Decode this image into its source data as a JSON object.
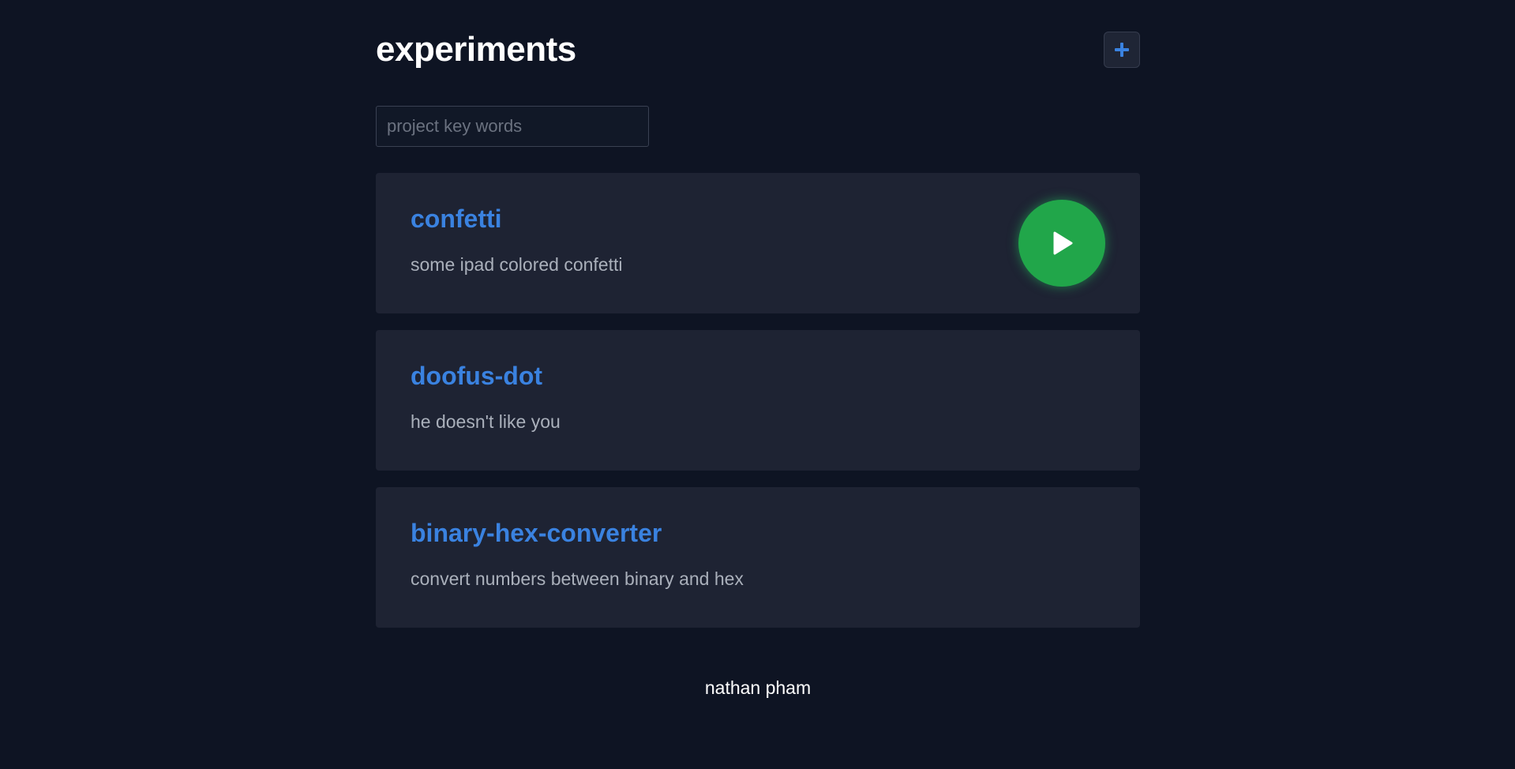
{
  "header": {
    "title": "experiments",
    "add_icon": "plus-icon",
    "accent_color": "#3a82e0"
  },
  "search": {
    "value": "",
    "placeholder": "project key words"
  },
  "projects": [
    {
      "title": "confetti",
      "description": "some ipad colored confetti",
      "action_icon": "play-icon",
      "action_color": "#21a64a"
    },
    {
      "title": "doofus-dot",
      "description": "he doesn't like you"
    },
    {
      "title": "binary-hex-converter",
      "description": "convert numbers between binary and hex"
    }
  ],
  "footer": {
    "author": "nathan pham"
  }
}
